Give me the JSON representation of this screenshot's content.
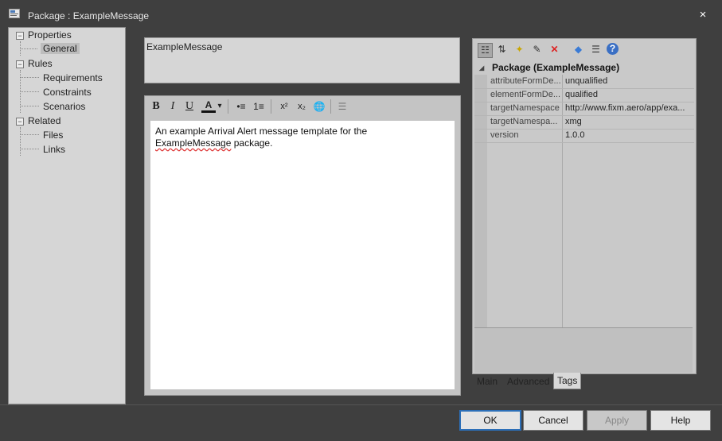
{
  "window": {
    "title": "Package : ExampleMessage",
    "close_label": "×",
    "app_icon": "package-dialog-icon"
  },
  "tree": {
    "items": [
      {
        "label": "Properties",
        "expander": "−"
      },
      {
        "label": "General"
      },
      {
        "label": "Rules",
        "expander": "−"
      },
      {
        "label": "Requirements"
      },
      {
        "label": "Constraints"
      },
      {
        "label": "Scenarios"
      },
      {
        "label": "Related",
        "expander": "−"
      },
      {
        "label": "Files"
      },
      {
        "label": "Links"
      }
    ],
    "selected": "General"
  },
  "name_field": {
    "value": "ExampleMessage"
  },
  "notes_editor": {
    "toolbar": {
      "bold": "B",
      "italic": "I",
      "underline": "U",
      "color": "A",
      "dropdown": "▾",
      "bullets": "•≡",
      "numbering": "1≡",
      "superscript": "x²",
      "subscript": "x₂",
      "hyperlink": "🌐",
      "docs": "☰"
    },
    "text_line1": "An example Arrival Alert message template for the",
    "text_line2_word": "ExampleMessage",
    "text_line2_rest": " package."
  },
  "properties": {
    "section": "Package (ExampleMessage)",
    "section_arrow": "◢",
    "rows": [
      {
        "key": "attributeFormDe...",
        "value": "unqualified"
      },
      {
        "key": "elementFormDe...",
        "value": "qualified"
      },
      {
        "key": "targetNamespace",
        "value": "http://www.fixm.aero/app/exa..."
      },
      {
        "key": "targetNamespa...",
        "value": "xmg"
      },
      {
        "key": "version",
        "value": "1.0.0"
      }
    ],
    "toolbar_icons": [
      "categorized-icon",
      "sort-alpha-icon",
      "new-tag-icon",
      "edit-tag-icon",
      "delete-icon",
      "tag-icon",
      "filter-icon",
      "help-icon"
    ],
    "toolbar_glyphs": [
      "☷",
      "⇅",
      "✦",
      "✎",
      "✕",
      "◆",
      "☰",
      "?"
    ]
  },
  "tabs": [
    {
      "label": "Main"
    },
    {
      "label": "Advanced"
    },
    {
      "label": "Tags"
    }
  ],
  "active_tab": "Tags",
  "buttons": {
    "ok": "OK",
    "cancel": "Cancel",
    "apply": "Apply",
    "help": "Help"
  },
  "colors": {
    "accent": "#2c6fb8",
    "error_squiggle": "#dd3333"
  }
}
